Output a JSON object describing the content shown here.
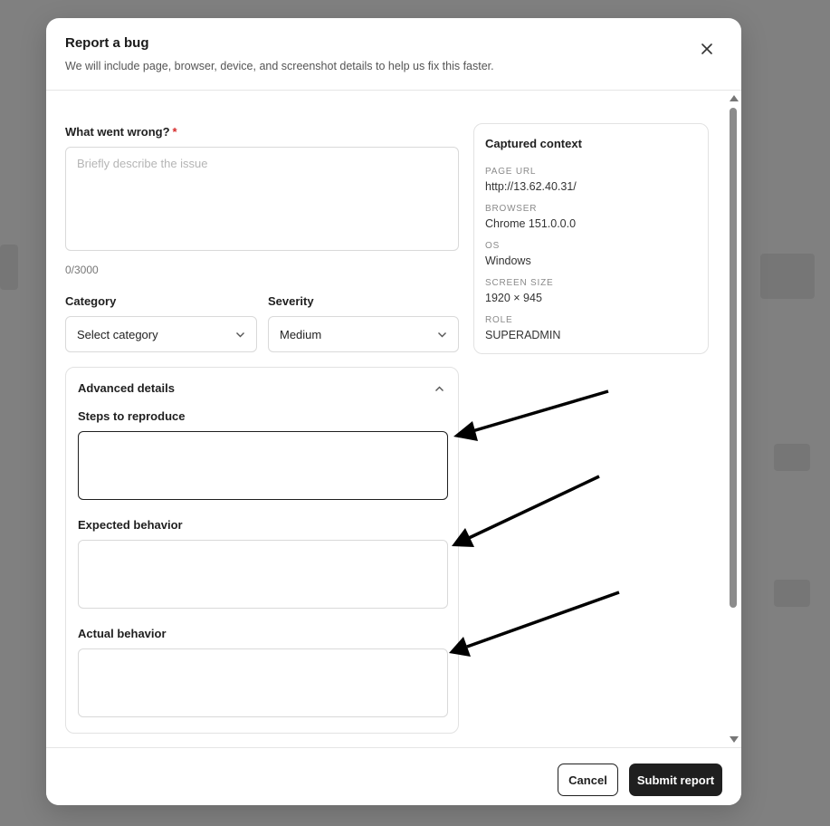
{
  "modal": {
    "title": "Report a bug",
    "subtitle": "We will include page, browser, device, and screenshot details to help us fix this faster.",
    "close_icon": "close-icon"
  },
  "form": {
    "what_went_wrong_label": "What went wrong?",
    "required_marker": "*",
    "description_placeholder": "Briefly describe the issue",
    "char_count": "0/3000",
    "category_label": "Category",
    "category_value": "Select category",
    "severity_label": "Severity",
    "severity_value": "Medium"
  },
  "advanced": {
    "title": "Advanced details",
    "steps_label": "Steps to reproduce",
    "expected_label": "Expected behavior",
    "actual_label": "Actual behavior"
  },
  "context": {
    "title": "Captured context",
    "items": [
      {
        "key": "PAGE URL",
        "value": "http://13.62.40.31/"
      },
      {
        "key": "BROWSER",
        "value": "Chrome 151.0.0.0"
      },
      {
        "key": "OS",
        "value": "Windows"
      },
      {
        "key": "SCREEN SIZE",
        "value": "1920 × 945"
      },
      {
        "key": "ROLE",
        "value": "SUPERADMIN"
      }
    ]
  },
  "footer": {
    "cancel_label": "Cancel",
    "submit_label": "Submit report"
  },
  "colors": {
    "accent": "#1f1f1f",
    "required": "#d62c2c",
    "overlay": "#808080"
  }
}
